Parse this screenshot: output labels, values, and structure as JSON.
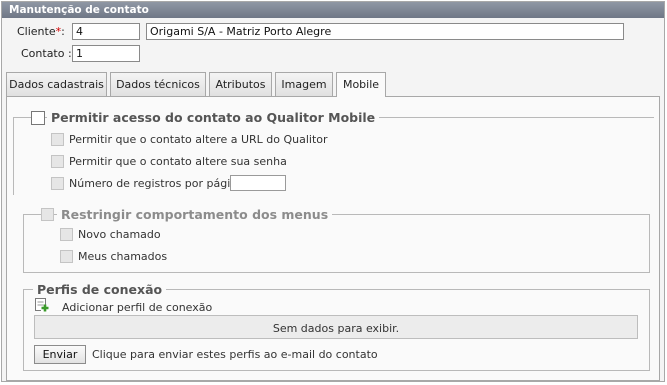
{
  "window": {
    "title": "Manutenção de contato"
  },
  "form": {
    "cliente_label": "Cliente",
    "required_mark": "*",
    "cliente_colon": ":",
    "cliente_id": "4",
    "cliente_name": "Origami S/A - Matriz Porto Alegre",
    "contato_label": "Contato :",
    "contato_value": "1"
  },
  "tabs": [
    {
      "label": "Dados cadastrais"
    },
    {
      "label": "Dados técnicos"
    },
    {
      "label": "Atributos"
    },
    {
      "label": "Imagem"
    },
    {
      "label": "Mobile",
      "active": true
    }
  ],
  "mobile": {
    "access_legend": "Permitir acesso do contato ao Qualitor Mobile",
    "options": [
      "Permitir que o contato altere a URL do Qualitor",
      "Permitir que o contato altere sua senha",
      "Número de registros por página"
    ],
    "records_per_page": "",
    "menus_legend": "Restringir comportamento dos menus",
    "menu_options": [
      "Novo chamado",
      "Meus chamados"
    ],
    "profiles_legend": "Perfis de conexão",
    "add_profile_label": "Adicionar perfil de conexão",
    "empty_text": "Sem dados para exibir.",
    "send_button": "Enviar",
    "send_hint": "Clique para enviar estes perfis ao e-mail do contato"
  },
  "colors": {
    "titlebar": "#7d8594",
    "required": "#d00000",
    "add_icon": "#3a9a2a"
  }
}
